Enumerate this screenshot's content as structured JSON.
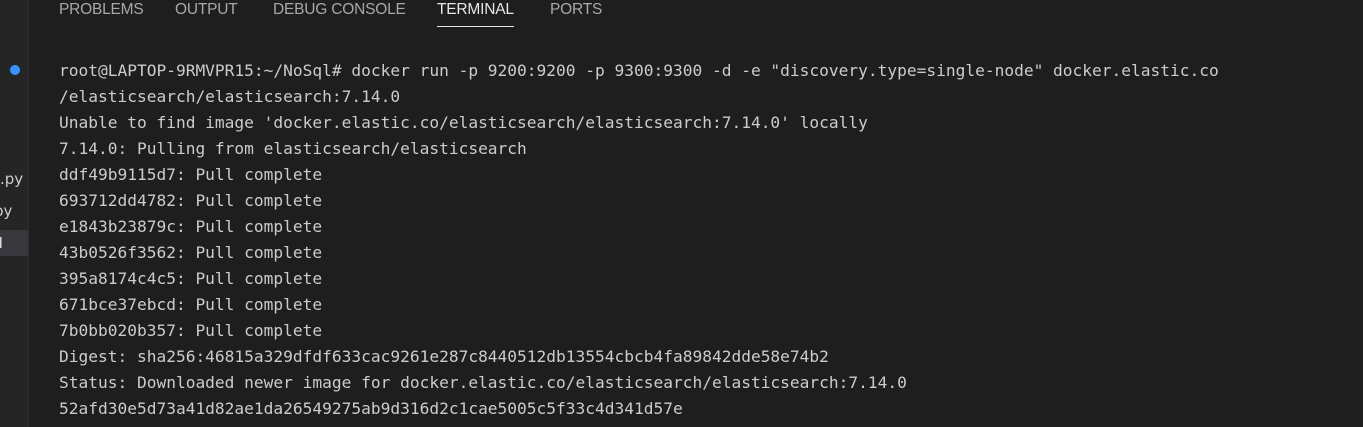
{
  "explorer": {
    "items": [
      {
        "label": ".py"
      },
      {
        "label": "py"
      },
      {
        "label": "M"
      }
    ]
  },
  "panel": {
    "tabs": [
      {
        "label": "PROBLEMS"
      },
      {
        "label": "OUTPUT"
      },
      {
        "label": "DEBUG CONSOLE"
      },
      {
        "label": "TERMINAL",
        "active": true
      },
      {
        "label": "PORTS"
      }
    ]
  },
  "terminal": {
    "lines": [
      "root@LAPTOP-9RMVPR15:~/NoSql# docker run -p 9200:9200 -p 9300:9300 -d -e \"discovery.type=single-node\" docker.elastic.co",
      "/elasticsearch/elasticsearch:7.14.0",
      "Unable to find image 'docker.elastic.co/elasticsearch/elasticsearch:7.14.0' locally",
      "7.14.0: Pulling from elasticsearch/elasticsearch",
      "ddf49b9115d7: Pull complete",
      "693712dd4782: Pull complete",
      "e1843b23879c: Pull complete",
      "43b0526f3562: Pull complete",
      "395a8174c4c5: Pull complete",
      "671bce37ebcd: Pull complete",
      "7b0bb020b357: Pull complete",
      "Digest: sha256:46815a329dfdf633cac9261e287c8440512db13554cbcb4fa89842dde58e74b2",
      "Status: Downloaded newer image for docker.elastic.co/elasticsearch/elasticsearch:7.14.0",
      "52afd30e5d73a41d82ae1da26549275ab9d316d2c1cae5005c5f33c4d341d57e"
    ]
  },
  "colors": {
    "background": "#1e1e1e",
    "text": "#cccccc",
    "tab_inactive": "#a8a8a8",
    "tab_active": "#e7e7e7",
    "command_dot": "#3794ff"
  }
}
